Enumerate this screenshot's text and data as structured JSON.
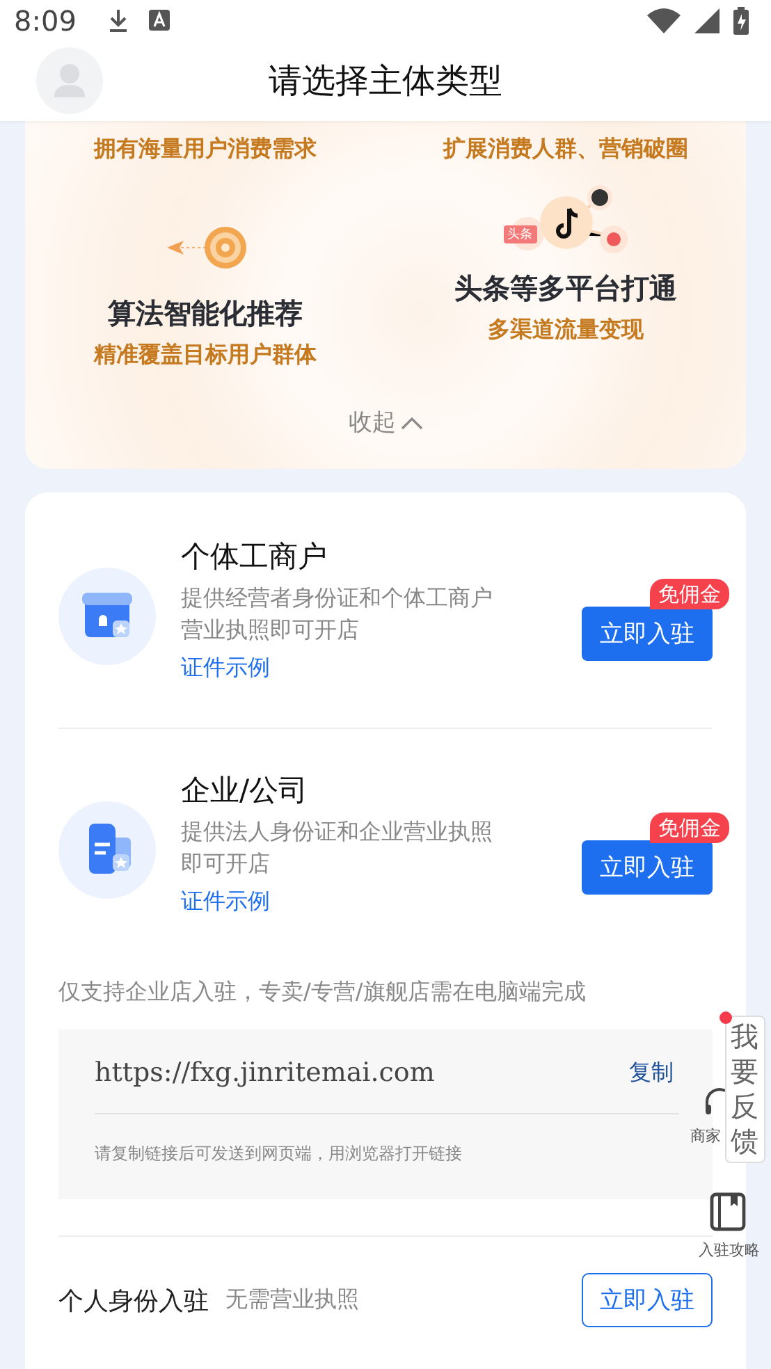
{
  "status_bar": {
    "time": "8:09"
  },
  "header": {
    "title": "请选择主体类型"
  },
  "features": {
    "top_subtitles": [
      "拥有海量用户消费需求",
      "扩展消费人群、营销破圈"
    ],
    "items": [
      {
        "kind": "algorithm",
        "title": "算法智能化推荐",
        "subtitle": "精准覆盖目标用户群体"
      },
      {
        "kind": "platforms",
        "title": "头条等多平台打通",
        "subtitle": "多渠道流量变现",
        "tag": "头条"
      }
    ],
    "collapse": "收起"
  },
  "merchant_types": [
    {
      "kind": "store",
      "name": "个体工商户",
      "description": "提供经营者身份证和个体工商户营业执照即可开店",
      "sample_link": "证件示例",
      "button": "立即入驻",
      "badge": "免佣金"
    },
    {
      "kind": "company",
      "name": "企业/公司",
      "description": "提供法人身份证和企业营业执照即可开店",
      "sample_link": "证件示例",
      "button": "立即入驻",
      "badge": "免佣金"
    }
  ],
  "notice": "仅支持企业店入驻，专卖/专营/旗舰店需在电脑端完成",
  "link_box": {
    "url": "https://fxg.jinritemai.com",
    "copy": "复制",
    "hint": "请复制链接后可发送到网页端，用浏览器打开链接"
  },
  "personal": {
    "title": "个人身份入驻",
    "note": "无需营业执照",
    "button": "立即入驻"
  },
  "floating": {
    "feedback": "我要反馈",
    "assistant": "商家",
    "guide": "入驻攻略"
  }
}
